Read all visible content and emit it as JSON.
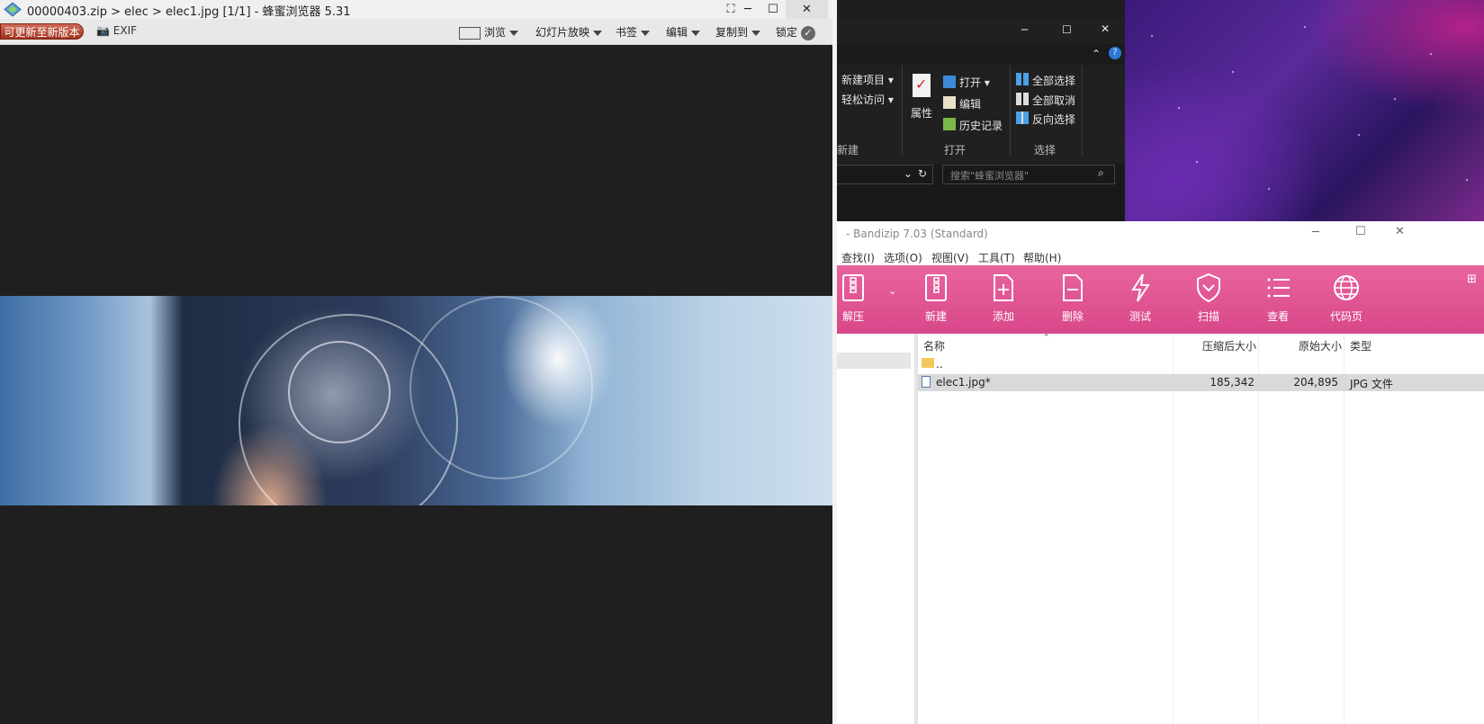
{
  "viewer": {
    "title": "00000403.zip > elec > elec1.jpg [1/1] - 蜂蜜浏览器 5.31",
    "update_label": "可更新至新版本",
    "exif_label": "EXIF",
    "menus": [
      "浏览",
      "幻灯片放映",
      "书签",
      "编辑",
      "复制到",
      "锁定"
    ]
  },
  "explorer": {
    "ribbon": {
      "new_item": "新建项目",
      "easy_access": "轻松访问",
      "new_group": "新建",
      "properties": "属性",
      "open": "打开",
      "edit": "编辑",
      "history": "历史记录",
      "open_group": "打开",
      "select_all": "全部选择",
      "select_none": "全部取消",
      "invert_select": "反向选择",
      "select_group": "选择"
    },
    "search_placeholder": "搜索\"蜂蜜浏览器\""
  },
  "bandizip": {
    "title": "- Bandizip 7.03 (Standard)",
    "menu": [
      "查找(I)",
      "选项(O)",
      "视图(V)",
      "工具(T)",
      "帮助(H)"
    ],
    "toolbar": [
      "解压",
      "新建",
      "添加",
      "删除",
      "测试",
      "扫描",
      "查看",
      "代码页"
    ],
    "columns": {
      "name": "名称",
      "compressed": "压缩后大小",
      "original": "原始大小",
      "type": "类型"
    },
    "rows": [
      {
        "name": "..",
        "compressed": "",
        "original": "",
        "type": ""
      },
      {
        "name": "elec1.jpg*",
        "compressed": "185,342",
        "original": "204,895",
        "type": "JPG 文件"
      }
    ]
  },
  "colors": {
    "bandizip_accent": "#e0528f",
    "update_button": "#b8402b"
  }
}
